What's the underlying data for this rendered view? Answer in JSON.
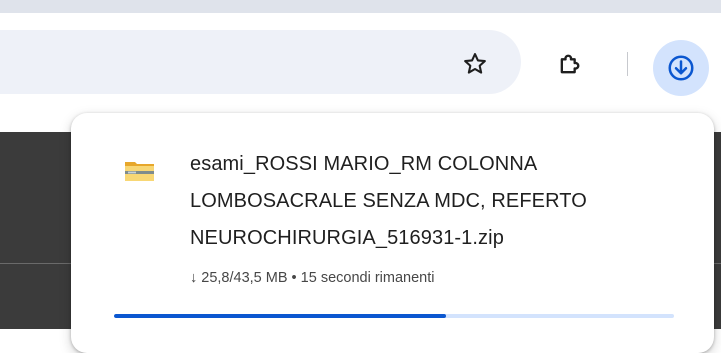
{
  "toolbar": {
    "bookmark_icon": "star-icon",
    "extensions_icon": "puzzle-piece-icon",
    "downloads_icon": "download-arrow-icon"
  },
  "download": {
    "file_icon": "folder-zip-icon",
    "file_name_line1": "esami_ROSSI MARIO_RM COLONNA",
    "file_name_line2": "LOMBOSACRALE SENZA MDC, REFERTO",
    "file_name_line3": "NEUROCHIRURGIA_516931-1.zip",
    "status": "↓ 25,8/43,5 MB • 15 secondi rimanenti",
    "progress": 0.593
  },
  "colors": {
    "accent": "#0b57d0",
    "accent_light": "#d3e3fd",
    "omnibox_bg": "#eef1f8",
    "page_bg": "#3b3b3b"
  }
}
